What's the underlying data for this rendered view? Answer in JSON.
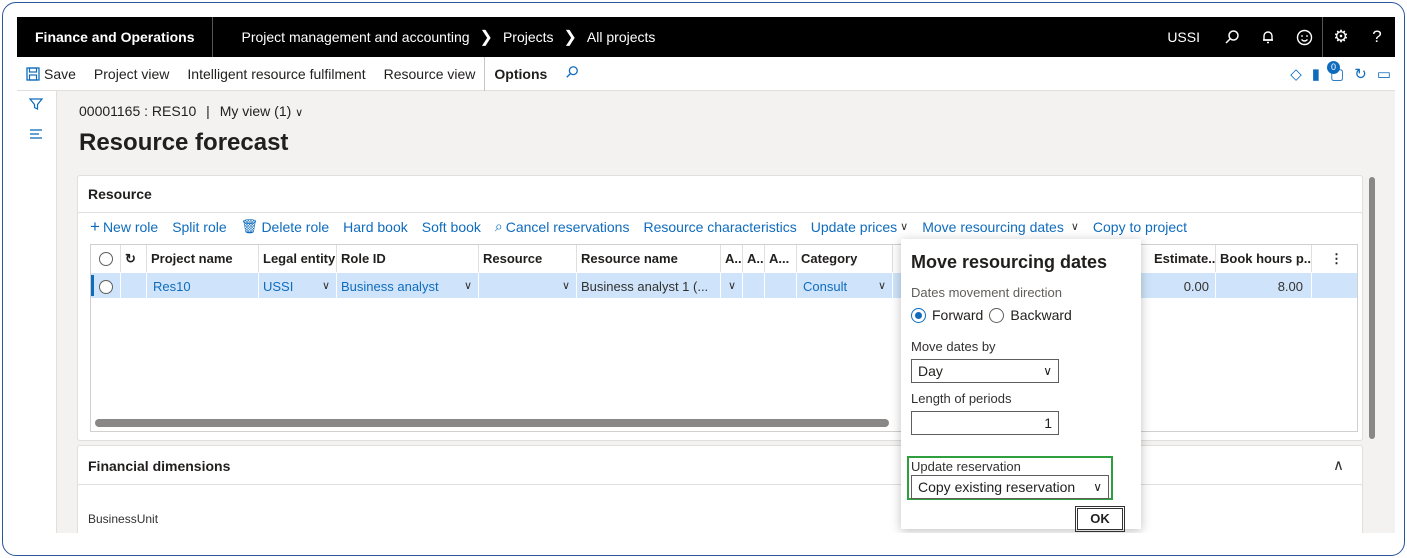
{
  "topbar": {
    "app_name": "Finance and Operations",
    "crumbs": [
      "Project management and accounting",
      "Projects",
      "All projects"
    ],
    "company": "USSI",
    "icons": [
      "search-icon",
      "bell-icon",
      "smiley-icon",
      "gear-icon",
      "help-icon"
    ],
    "help_glyph": "?"
  },
  "actionpane": {
    "save": "Save",
    "items": [
      "Project view",
      "Intelligent resource fulfilment",
      "Resource view"
    ],
    "options": "Options",
    "badge": "0"
  },
  "header": {
    "record": "00001165 : RES10",
    "separator": "|",
    "view": "My view (1)"
  },
  "page_title": "Resource forecast",
  "resource_section": {
    "title": "Resource",
    "toolbar": {
      "new_role": "New role",
      "split_role": "Split role",
      "delete_role": "Delete role",
      "hard_book": "Hard book",
      "soft_book": "Soft book",
      "cancel_reservations": "Cancel reservations",
      "resource_characteristics": "Resource characteristics",
      "update_prices": "Update prices",
      "move_resourcing_dates": "Move resourcing dates",
      "copy_to_project": "Copy to project"
    },
    "columns": {
      "project_name": "Project name",
      "legal_entity": "Legal entity",
      "role_id": "Role ID",
      "resource": "Resource",
      "resource_name": "Resource name",
      "a1": "A...",
      "a2": "A...",
      "a3": "A...",
      "category": "Category",
      "estimate": "Estimate...",
      "book_hours": "Book hours p..."
    },
    "row": {
      "project_name": "Res10",
      "legal_entity": "USSI",
      "role_id": "Business analyst",
      "resource": "",
      "resource_name": "Business analyst 1 (...",
      "category": "Consult",
      "estimate": "0.00",
      "book_hours": "8.00"
    }
  },
  "financial_section": {
    "title": "Financial dimensions",
    "business_unit_label": "BusinessUnit"
  },
  "dialog": {
    "title": "Move resourcing dates",
    "direction_label": "Dates movement direction",
    "forward": "Forward",
    "backward": "Backward",
    "move_by_label": "Move dates by",
    "move_by_value": "Day",
    "length_label": "Length of periods",
    "length_value": "1",
    "update_reservation_label": "Update reservation",
    "update_reservation_value": "Copy existing reservation",
    "ok": "OK"
  },
  "colors": {
    "accent": "#0f6cbd",
    "selected_row": "#cfe4fa",
    "highlight": "#2e9e3e",
    "nav_bg": "#000000"
  }
}
